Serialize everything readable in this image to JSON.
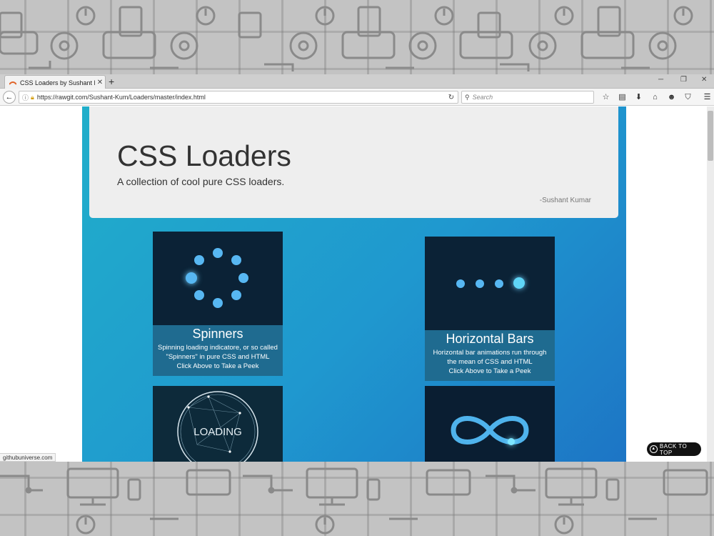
{
  "browser": {
    "tab_title": "CSS Loaders by Sushant K...",
    "new_tab_icon": "plus-icon",
    "url": "https://rawgit.com/Sushant-Kum/Loaders/master/index.html",
    "search_placeholder": "Search",
    "status_text": "githubuniverse.com"
  },
  "hero": {
    "title": "CSS Loaders",
    "subtitle": "A collection of cool pure CSS loaders.",
    "author": "-Sushant Kumar"
  },
  "cards": [
    {
      "title": "Spinners",
      "description": "Spinning loading indicatore, or so called \"Spinners\" in pure CSS and HTML",
      "cta": "Click Above to Take a Peek"
    },
    {
      "title": "Horizontal Bars",
      "description": "Horizontal bar animations run through the mean of CSS and HTML",
      "cta": "Click Above to Take a Peek"
    },
    {
      "loading_text": "LOADING"
    }
  ],
  "back_to_top": "BACK TO TOP",
  "colors": {
    "page_gradient_start": "#21aeca",
    "page_gradient_end": "#1d75c5",
    "card_bg": "#0b2236",
    "accent_dot": "#57b7f2"
  }
}
